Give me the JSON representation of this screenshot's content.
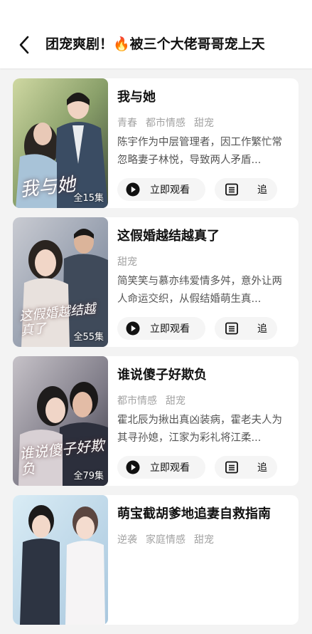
{
  "header": {
    "title": "团宠爽剧！🔥被三个大佬哥哥宠上天"
  },
  "dramas": [
    {
      "title": "我与她",
      "tags": [
        "青春",
        "都市情感",
        "甜宠"
      ],
      "description": "陈宇作为中层管理者，因工作繁忙常忽略妻子林悦，导致两人矛盾...",
      "poster_text": "我与她",
      "episodes": "全15集",
      "watch_label": "立即观看",
      "follow_label": "追"
    },
    {
      "title": "这假婚越结越真了",
      "tags": [
        "甜宠"
      ],
      "description": "简笑笑与慕亦纬爱情多舛，意外让两人命运交织，从假结婚萌生真...",
      "poster_text": "这假婚越结越真了",
      "episodes": "全55集",
      "watch_label": "立即观看",
      "follow_label": "追"
    },
    {
      "title": "谁说傻子好欺负",
      "tags": [
        "都市情感",
        "甜宠"
      ],
      "description": "霍北辰为揪出真凶装病，霍老夫人为其寻孙媳，江家为彩礼将江柔...",
      "poster_text": "谁说傻子好欺负",
      "episodes": "全79集",
      "watch_label": "立即观看",
      "follow_label": "追"
    },
    {
      "title": "萌宝截胡爹地追妻自救指南",
      "tags": [
        "逆袭",
        "家庭情感",
        "甜宠"
      ],
      "description": "",
      "poster_text": "",
      "episodes": "",
      "watch_label": "",
      "follow_label": ""
    }
  ]
}
